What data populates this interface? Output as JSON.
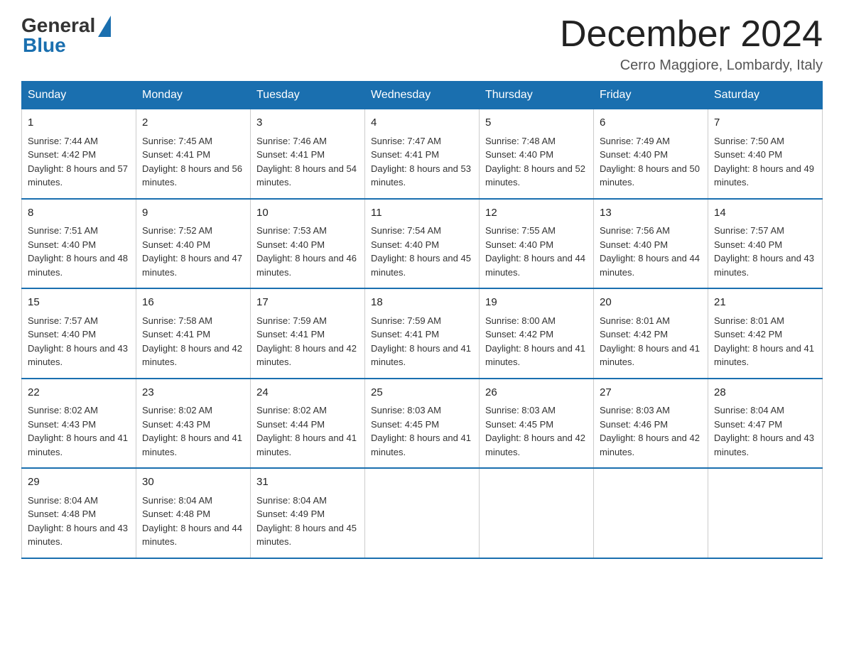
{
  "logo": {
    "general": "General",
    "blue": "Blue"
  },
  "title": "December 2024",
  "location": "Cerro Maggiore, Lombardy, Italy",
  "days": [
    "Sunday",
    "Monday",
    "Tuesday",
    "Wednesday",
    "Thursday",
    "Friday",
    "Saturday"
  ],
  "weeks": [
    [
      {
        "day": "1",
        "sunrise": "7:44 AM",
        "sunset": "4:42 PM",
        "daylight": "8 hours and 57 minutes."
      },
      {
        "day": "2",
        "sunrise": "7:45 AM",
        "sunset": "4:41 PM",
        "daylight": "8 hours and 56 minutes."
      },
      {
        "day": "3",
        "sunrise": "7:46 AM",
        "sunset": "4:41 PM",
        "daylight": "8 hours and 54 minutes."
      },
      {
        "day": "4",
        "sunrise": "7:47 AM",
        "sunset": "4:41 PM",
        "daylight": "8 hours and 53 minutes."
      },
      {
        "day": "5",
        "sunrise": "7:48 AM",
        "sunset": "4:40 PM",
        "daylight": "8 hours and 52 minutes."
      },
      {
        "day": "6",
        "sunrise": "7:49 AM",
        "sunset": "4:40 PM",
        "daylight": "8 hours and 50 minutes."
      },
      {
        "day": "7",
        "sunrise": "7:50 AM",
        "sunset": "4:40 PM",
        "daylight": "8 hours and 49 minutes."
      }
    ],
    [
      {
        "day": "8",
        "sunrise": "7:51 AM",
        "sunset": "4:40 PM",
        "daylight": "8 hours and 48 minutes."
      },
      {
        "day": "9",
        "sunrise": "7:52 AM",
        "sunset": "4:40 PM",
        "daylight": "8 hours and 47 minutes."
      },
      {
        "day": "10",
        "sunrise": "7:53 AM",
        "sunset": "4:40 PM",
        "daylight": "8 hours and 46 minutes."
      },
      {
        "day": "11",
        "sunrise": "7:54 AM",
        "sunset": "4:40 PM",
        "daylight": "8 hours and 45 minutes."
      },
      {
        "day": "12",
        "sunrise": "7:55 AM",
        "sunset": "4:40 PM",
        "daylight": "8 hours and 44 minutes."
      },
      {
        "day": "13",
        "sunrise": "7:56 AM",
        "sunset": "4:40 PM",
        "daylight": "8 hours and 44 minutes."
      },
      {
        "day": "14",
        "sunrise": "7:57 AM",
        "sunset": "4:40 PM",
        "daylight": "8 hours and 43 minutes."
      }
    ],
    [
      {
        "day": "15",
        "sunrise": "7:57 AM",
        "sunset": "4:40 PM",
        "daylight": "8 hours and 43 minutes."
      },
      {
        "day": "16",
        "sunrise": "7:58 AM",
        "sunset": "4:41 PM",
        "daylight": "8 hours and 42 minutes."
      },
      {
        "day": "17",
        "sunrise": "7:59 AM",
        "sunset": "4:41 PM",
        "daylight": "8 hours and 42 minutes."
      },
      {
        "day": "18",
        "sunrise": "7:59 AM",
        "sunset": "4:41 PM",
        "daylight": "8 hours and 41 minutes."
      },
      {
        "day": "19",
        "sunrise": "8:00 AM",
        "sunset": "4:42 PM",
        "daylight": "8 hours and 41 minutes."
      },
      {
        "day": "20",
        "sunrise": "8:01 AM",
        "sunset": "4:42 PM",
        "daylight": "8 hours and 41 minutes."
      },
      {
        "day": "21",
        "sunrise": "8:01 AM",
        "sunset": "4:42 PM",
        "daylight": "8 hours and 41 minutes."
      }
    ],
    [
      {
        "day": "22",
        "sunrise": "8:02 AM",
        "sunset": "4:43 PM",
        "daylight": "8 hours and 41 minutes."
      },
      {
        "day": "23",
        "sunrise": "8:02 AM",
        "sunset": "4:43 PM",
        "daylight": "8 hours and 41 minutes."
      },
      {
        "day": "24",
        "sunrise": "8:02 AM",
        "sunset": "4:44 PM",
        "daylight": "8 hours and 41 minutes."
      },
      {
        "day": "25",
        "sunrise": "8:03 AM",
        "sunset": "4:45 PM",
        "daylight": "8 hours and 41 minutes."
      },
      {
        "day": "26",
        "sunrise": "8:03 AM",
        "sunset": "4:45 PM",
        "daylight": "8 hours and 42 minutes."
      },
      {
        "day": "27",
        "sunrise": "8:03 AM",
        "sunset": "4:46 PM",
        "daylight": "8 hours and 42 minutes."
      },
      {
        "day": "28",
        "sunrise": "8:04 AM",
        "sunset": "4:47 PM",
        "daylight": "8 hours and 43 minutes."
      }
    ],
    [
      {
        "day": "29",
        "sunrise": "8:04 AM",
        "sunset": "4:48 PM",
        "daylight": "8 hours and 43 minutes."
      },
      {
        "day": "30",
        "sunrise": "8:04 AM",
        "sunset": "4:48 PM",
        "daylight": "8 hours and 44 minutes."
      },
      {
        "day": "31",
        "sunrise": "8:04 AM",
        "sunset": "4:49 PM",
        "daylight": "8 hours and 45 minutes."
      },
      null,
      null,
      null,
      null
    ]
  ]
}
